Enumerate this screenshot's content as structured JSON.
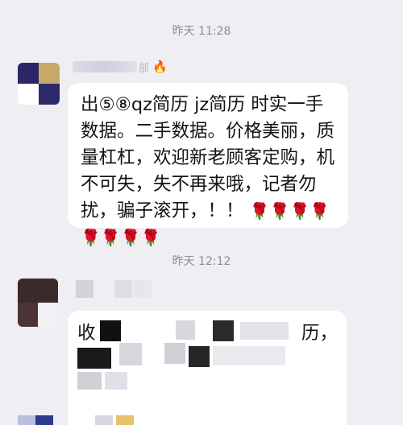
{
  "chat": {
    "timestamp_1": "昨天 11:28",
    "sender_1": {
      "name_visible_tail": "部",
      "badge_icon": "fire-icon",
      "avatar_colors": [
        "#2b2766",
        "#c8a868",
        "#ffffff",
        "#2d2a6a"
      ]
    },
    "message_1": {
      "text": "出⑤⑧qz简历  jz简历  时实一手数据。二手数据。价格美丽，质量杠杠，欢迎新老顾客定购，机不可失，失不再来哦，记者勿扰，骗子滚开，！！",
      "rose_icon": "🌹",
      "rose_count": 8
    },
    "timestamp_2": "昨天 12:12",
    "sender_2": {
      "avatar_colors": [
        "#3a2a2a",
        "#f1f1f4"
      ]
    },
    "message_2": {
      "visible_start": "收",
      "visible_fragment": "历，",
      "mosaic_colors": [
        "#111111",
        "#cfcfd6",
        "#2a2a2a",
        "#e8e8ec"
      ]
    },
    "footer_avatars": {
      "colors": [
        "#2b3a8c",
        "#e6c06a"
      ]
    }
  }
}
